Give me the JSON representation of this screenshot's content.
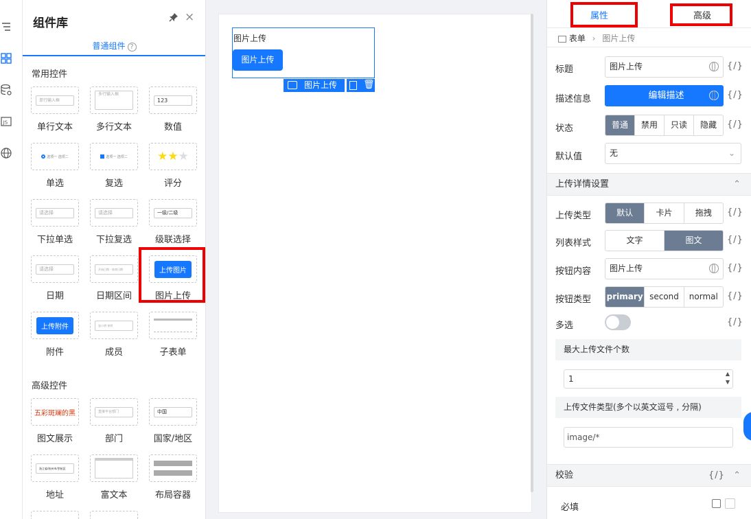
{
  "library": {
    "title": "组件库",
    "tab": "普通组件",
    "help": "?",
    "sections": {
      "common": "常用控件",
      "advanced": "高级控件"
    },
    "common_items": [
      {
        "label": "单行文本",
        "preview": "单行输入框"
      },
      {
        "label": "多行文本",
        "preview": "多行输入框"
      },
      {
        "label": "数值",
        "preview": "123"
      },
      {
        "label": "单选",
        "preview": "选项一  选项二"
      },
      {
        "label": "复选",
        "preview": "选项一  选项二"
      },
      {
        "label": "评分",
        "preview": "★★★"
      },
      {
        "label": "下拉单选",
        "preview": "请选择"
      },
      {
        "label": "下拉复选",
        "preview": "请选择"
      },
      {
        "label": "级联选择",
        "preview": "一级/二级"
      },
      {
        "label": "日期",
        "preview": "请选择"
      },
      {
        "label": "日期区间",
        "preview": "开始日期 - 结束日期"
      },
      {
        "label": "图片上传",
        "preview": "上传图片"
      },
      {
        "label": "附件",
        "preview": "上传附件"
      },
      {
        "label": "成员",
        "preview": "张小明 李明"
      },
      {
        "label": "子表单",
        "preview": ""
      }
    ],
    "advanced_items": [
      {
        "label": "图文展示",
        "preview": "五彩斑斓的黑"
      },
      {
        "label": "部门",
        "preview": "直接平台部门"
      },
      {
        "label": "国家/地区",
        "preview": "中国"
      },
      {
        "label": "地址",
        "preview": "浙江省/杭州市/余杭区"
      },
      {
        "label": "富文本",
        "preview": ""
      },
      {
        "label": "布局容器",
        "preview": ""
      }
    ]
  },
  "canvas": {
    "field_title": "图片上传",
    "button": "图片上传",
    "tag": "图片上传"
  },
  "panel": {
    "tabs": [
      "属性",
      "高级"
    ],
    "breadcrumb": [
      "表单",
      "图片上传"
    ],
    "fx": "{/}",
    "title_label": "标题",
    "title_value": "图片上传",
    "desc_label": "描述信息",
    "desc_button": "编辑描述",
    "state_label": "状态",
    "state_options": [
      "普通",
      "禁用",
      "只读",
      "隐藏"
    ],
    "default_label": "默认值",
    "default_value": "无",
    "upload_group": "上传详情设置",
    "upload_type_label": "上传类型",
    "upload_type_options": [
      "默认",
      "卡片",
      "拖拽"
    ],
    "list_style_label": "列表样式",
    "list_style_options": [
      "文字",
      "图文"
    ],
    "btn_content_label": "按钮内容",
    "btn_content_value": "图片上传",
    "btn_type_label": "按钮类型",
    "btn_type_options": [
      "primary",
      "second",
      "normal"
    ],
    "multi_label": "多选",
    "max_files_label": "最大上传文件个数",
    "max_files_value": "1",
    "file_types_label": "上传文件类型(多个以英文逗号 , 分隔)",
    "file_types_value": "image/*",
    "validate_group": "校验",
    "required_label": "必填"
  }
}
